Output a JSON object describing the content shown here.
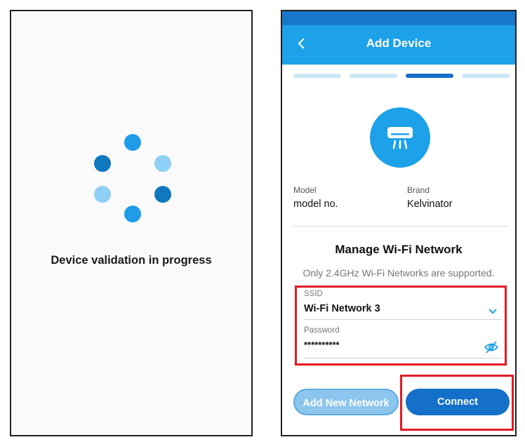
{
  "loading_screen": {
    "message": "Device validation in progress",
    "spinner_colors": [
      "#1f9be8",
      "#8ed0f5",
      "#0f78bf",
      "#1f9be8",
      "#8ed0f5",
      "#0f78bf"
    ]
  },
  "add_device": {
    "header": {
      "back_icon": "chevron-left-icon",
      "title": "Add Device"
    },
    "progress": {
      "total_steps": 4,
      "current_step": 3
    },
    "device_icon": "air-conditioner-icon",
    "model": {
      "label": "Model",
      "value": "model no."
    },
    "brand": {
      "label": "Brand",
      "value": "Kelvinator"
    },
    "wifi_section": {
      "title": "Manage Wi-Fi Network",
      "notice": "Only 2.4GHz Wi-Fi Networks are supported.",
      "ssid": {
        "label": "SSID",
        "value": "Wi-Fi Network 3"
      },
      "password": {
        "label": "Password",
        "value": "**********"
      }
    },
    "buttons": {
      "add_new_network": "Add New Network",
      "connect": "Connect"
    }
  },
  "colors": {
    "app_bar": "#1da1e8",
    "status_bar": "#1877c9",
    "step_active": "#1470c8",
    "step_inactive": "#cde7f8",
    "highlight": "#e41b23"
  }
}
